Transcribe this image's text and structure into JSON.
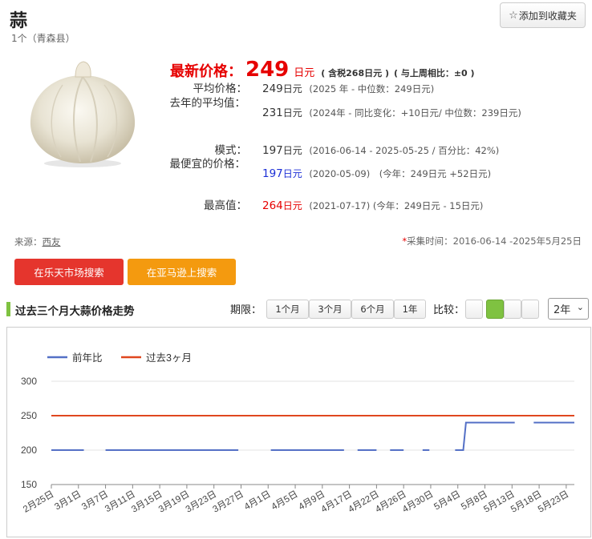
{
  "product": {
    "name": "蒜",
    "subtitle": "1个（青森县）"
  },
  "favorite_button": "添加到收藏夹",
  "latest": {
    "label": "最新价格：",
    "price": "249",
    "unit": "日元",
    "tax_note": "( 含税268日元 )",
    "week_note": "( 与上周相比：±0 )"
  },
  "stats": [
    {
      "label": "平均价格：",
      "value": "249",
      "unit": "日元",
      "value_color": "default",
      "note_parts": [
        {
          "text": "(2025 年 - 中位数：249日元)",
          "color": "default"
        }
      ]
    },
    {
      "label": "去年的平均值：",
      "value": "231",
      "unit": "日元",
      "value_color": "default",
      "note_parts": [
        {
          "text": "(2024年 - 同比变化：",
          "color": "default"
        },
        {
          "text": "+10日元",
          "color": "red"
        },
        {
          "text": "/ 中位数：239日元)",
          "color": "default"
        }
      ]
    },
    {
      "label": "模式：",
      "value": "197",
      "unit": "日元",
      "value_color": "default",
      "note_parts": [
        {
          "text": "(2016-06-14 - 2025-05-25 / 百分比：42%)",
          "color": "default"
        }
      ]
    },
    {
      "label": "最便宜的价格：",
      "value": "197",
      "unit": "日元",
      "value_color": "blue",
      "note_parts": [
        {
          "text": "(2020-05-09)　(今年：249日元 ",
          "color": "default"
        },
        {
          "text": "+52日元",
          "color": "red"
        },
        {
          "text": ")",
          "color": "default"
        }
      ]
    },
    {
      "label": "最高值：",
      "value": "264",
      "unit": "日元",
      "value_color": "red",
      "note_parts": [
        {
          "text": "(2021-07-17) (今年：249日元 - ",
          "color": "default"
        },
        {
          "text": "15日元",
          "color": "blue"
        },
        {
          "text": ")",
          "color": "default"
        }
      ]
    }
  ],
  "source": {
    "label": "来源：",
    "link": "西友"
  },
  "collected": {
    "asterisk": "*",
    "text": "采集时间：2016-06-14 -2025年5月25日"
  },
  "buttons": {
    "rakuten": "在乐天市场搜索",
    "amazon": "在亚马逊上搜索"
  },
  "section_title": "过去三个月大蒜价格走势",
  "controls": {
    "period_label": "期限：",
    "periods": [
      "1个月",
      "3个月",
      "6个月",
      "1年"
    ],
    "compare_label": "比较：",
    "compare_active_index": 1,
    "select_value": "2年"
  },
  "colors": {
    "accent_red": "#e60000",
    "green": "#7fc241",
    "orange": "#f49a0f",
    "button_red": "#e5352d",
    "series_last_year": "#5470c6",
    "series_3m": "#e0471f"
  },
  "chart_data": {
    "type": "line",
    "title": "",
    "xlabel": "",
    "ylabel": "",
    "ylim": [
      150,
      300
    ],
    "yticks": [
      150,
      200,
      250,
      300
    ],
    "grid": true,
    "legend_position": "top-left",
    "x_tick_labels": [
      "2月25日",
      "3月1日",
      "3月7日",
      "3月11日",
      "3月15日",
      "3月19日",
      "3月23日",
      "3月27日",
      "4月1日",
      "4月5日",
      "4月9日",
      "4月17日",
      "4月22日",
      "4月26日",
      "4月30日",
      "5月4日",
      "5月8日",
      "5月13日",
      "5月18日",
      "5月23日"
    ],
    "x_index_range": [
      0,
      19.3
    ],
    "series": [
      {
        "name": "前年比",
        "color": "#5470c6",
        "segments": [
          [
            [
              0,
              200
            ],
            [
              1.2,
              200
            ]
          ],
          [
            [
              2,
              200
            ],
            [
              6.9,
              200
            ]
          ],
          [
            [
              8.1,
              200
            ],
            [
              10.8,
              200
            ]
          ],
          [
            [
              11.3,
              200
            ],
            [
              12,
              200
            ]
          ],
          [
            [
              12.5,
              200
            ],
            [
              13,
              200
            ]
          ],
          [
            [
              13.7,
              200
            ],
            [
              13.95,
              200
            ]
          ],
          [
            [
              14.9,
              200
            ],
            [
              15.2,
              200
            ],
            [
              15.3,
              240
            ],
            [
              17.1,
              240
            ]
          ],
          [
            [
              17.8,
              240
            ],
            [
              19.3,
              240
            ]
          ]
        ]
      },
      {
        "name": "过去3ヶ月",
        "color": "#e0471f",
        "segments": [
          [
            [
              0,
              250
            ],
            [
              19.3,
              250
            ]
          ]
        ]
      }
    ]
  }
}
